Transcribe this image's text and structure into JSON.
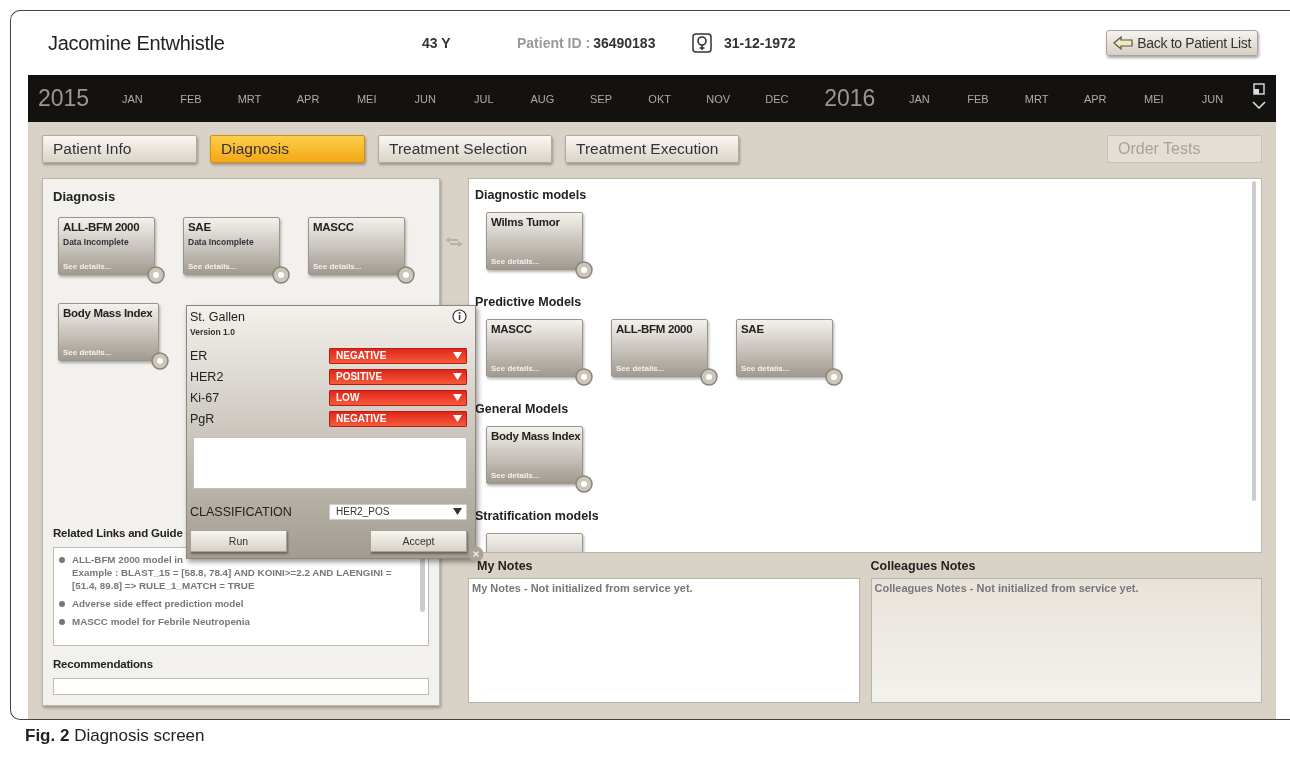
{
  "patient": {
    "name": "Jacomine  Entwhistle",
    "age": "43 Y",
    "id_label": "Patient ID :",
    "id_value": "36490183",
    "birth_date": "31-12-1972"
  },
  "back_button": "Back to Patient List",
  "timeline": [
    {
      "kind": "year",
      "label": "2015"
    },
    {
      "kind": "month",
      "label": "JAN"
    },
    {
      "kind": "month",
      "label": "FEB"
    },
    {
      "kind": "month",
      "label": "MRT"
    },
    {
      "kind": "month",
      "label": "APR"
    },
    {
      "kind": "month",
      "label": "MEI"
    },
    {
      "kind": "month",
      "label": "JUN"
    },
    {
      "kind": "month",
      "label": "JUL"
    },
    {
      "kind": "month",
      "label": "AUG"
    },
    {
      "kind": "month",
      "label": "SEP"
    },
    {
      "kind": "month",
      "label": "OKT"
    },
    {
      "kind": "month",
      "label": "NOV"
    },
    {
      "kind": "month",
      "label": "DEC"
    },
    {
      "kind": "year",
      "label": "2016"
    },
    {
      "kind": "month",
      "label": "JAN"
    },
    {
      "kind": "month",
      "label": "FEB"
    },
    {
      "kind": "month",
      "label": "MRT"
    },
    {
      "kind": "month",
      "label": "APR"
    },
    {
      "kind": "month",
      "label": "MEI"
    },
    {
      "kind": "month",
      "label": "JUN"
    }
  ],
  "tabs": [
    {
      "label": "Patient Info",
      "selected": false
    },
    {
      "label": "Diagnosis",
      "selected": true
    },
    {
      "label": "Treatment Selection",
      "selected": false
    },
    {
      "label": "Treatment Execution",
      "selected": false
    }
  ],
  "order_tests": {
    "label": "Order Tests",
    "disabled": true
  },
  "diagnosis_panel": {
    "title": "Diagnosis",
    "cards": [
      {
        "title": "ALL-BFM 2000",
        "status": "Data Incomplete",
        "link": "See details..."
      },
      {
        "title": "SAE",
        "status": "Data Incomplete",
        "link": "See details..."
      },
      {
        "title": "MASCC",
        "link": "See details..."
      },
      {
        "title": "Body Mass Index",
        "link": "See details..."
      }
    ],
    "links_title": "Related Links and Guide",
    "links": [
      {
        "lines": [
          "ALL-BFM 2000 model in",
          "Example : BLAST_15 = [58.8, 78.4] AND KOINI>=2.2 AND LAENGINI = [51.4, 89.8] => RULE_1_MATCH = TRUE"
        ]
      },
      {
        "lines": [
          "Adverse side effect prediction model"
        ]
      },
      {
        "lines": [
          "MASCC model for Febrile Neutropenia"
        ]
      }
    ],
    "recommendations_title": "Recommendations"
  },
  "model_dialog": {
    "title": "St. Gallen",
    "version": "Version 1.0",
    "params": [
      {
        "name": "ER",
        "value": "NEGATIVE",
        "flagged": true
      },
      {
        "name": "HER2",
        "value": "POSITIVE",
        "flagged": true
      },
      {
        "name": "Ki-67",
        "value": "LOW",
        "flagged": true
      },
      {
        "name": "PgR",
        "value": "NEGATIVE",
        "flagged": true
      }
    ],
    "classification_label": "CLASSIFICATION",
    "classification_value": "HER2_POS",
    "buttons": [
      "Run",
      "Accept"
    ]
  },
  "model_library": [
    {
      "title": "Diagnostic models",
      "cards": [
        {
          "title": "Wilms Tumor",
          "link": "See details..."
        }
      ]
    },
    {
      "title": "Predictive Models",
      "cards": [
        {
          "title": "MASCC",
          "link": "See details..."
        },
        {
          "title": "ALL-BFM 2000",
          "link": "See details..."
        },
        {
          "title": "SAE",
          "link": "See details..."
        }
      ]
    },
    {
      "title": "General Models",
      "cards": [
        {
          "title": "Body Mass Index",
          "link": "See details..."
        }
      ]
    },
    {
      "title": "Stratification models",
      "cards": [
        {
          "kind": "cut"
        }
      ]
    }
  ],
  "notes": [
    {
      "title": "My Notes",
      "placeholder": "My Notes - Not initialized from service yet.",
      "editable": true
    },
    {
      "title": "Colleagues Notes",
      "placeholder": "Colleagues Notes - Not initialized from service yet.",
      "editable": false
    }
  ],
  "caption": "**Fig. 2** Diagnosis screen"
}
